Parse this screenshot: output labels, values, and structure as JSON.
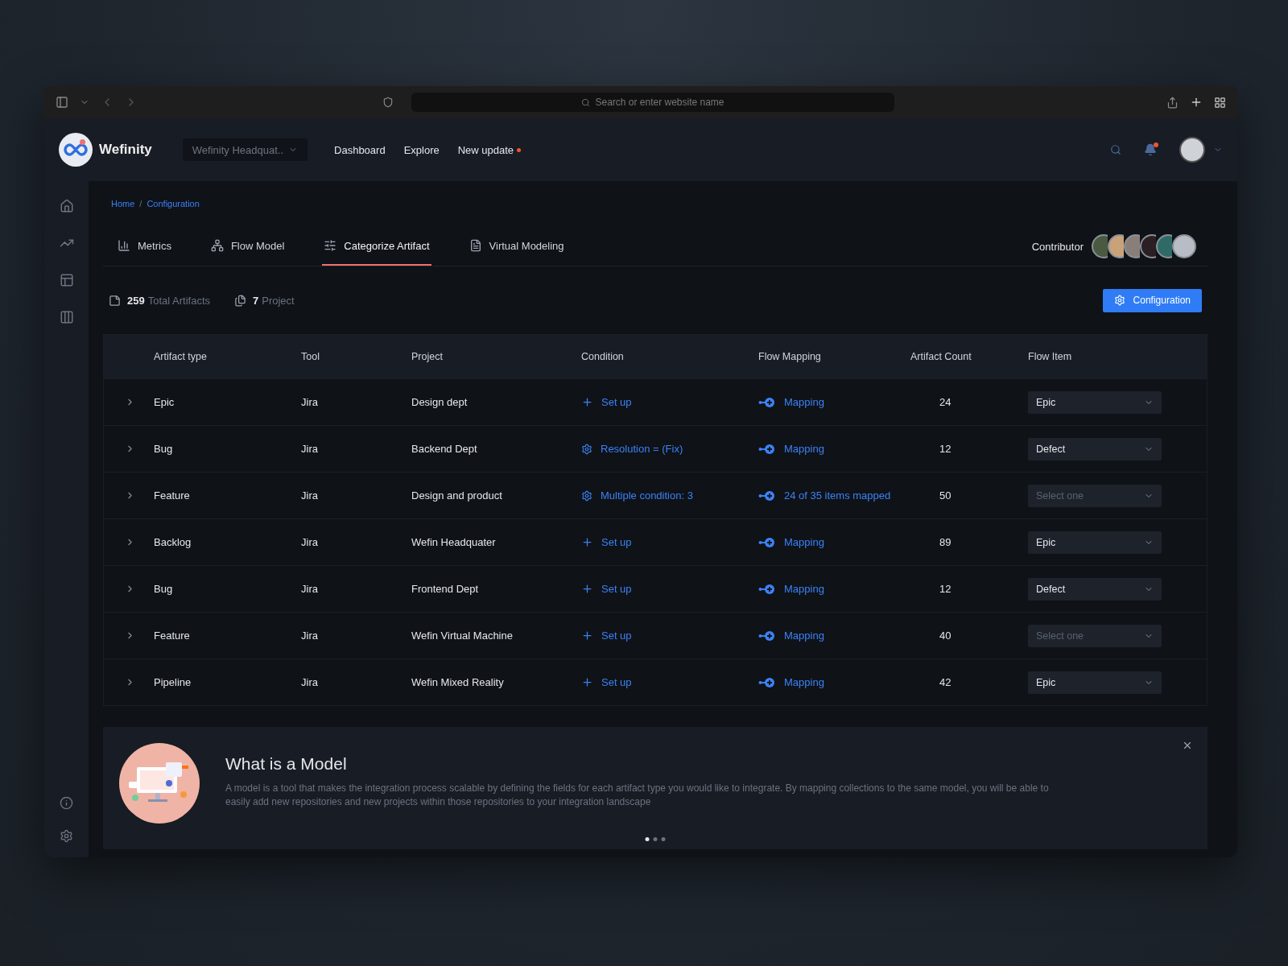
{
  "browser": {
    "address_placeholder": "Search or enter website name"
  },
  "header": {
    "brand": "Wefinity",
    "workspace": "Wefinity Headquat..",
    "nav": [
      {
        "label": "Dashboard",
        "badge": false
      },
      {
        "label": "Explore",
        "badge": false
      },
      {
        "label": "New update",
        "badge": true
      }
    ],
    "notifications": true
  },
  "sidebar": {
    "items": [
      {
        "kind": "home",
        "selected": false
      },
      {
        "kind": "chart",
        "selected": false
      },
      {
        "kind": "layout",
        "selected": false
      },
      {
        "kind": "board",
        "selected": false
      }
    ],
    "bottom": [
      {
        "kind": "info"
      },
      {
        "kind": "settings"
      }
    ]
  },
  "breadcrumb": {
    "items": [
      "Home",
      "Configuration"
    ],
    "separator": "/"
  },
  "tabs": [
    {
      "label": "Metrics",
      "kind": "metrics",
      "selected": false
    },
    {
      "label": "Flow Model",
      "kind": "flow",
      "selected": false
    },
    {
      "label": "Categorize Artifact",
      "kind": "sliders",
      "selected": true
    },
    {
      "label": "Virtual Modeling",
      "kind": "doc",
      "selected": false
    }
  ],
  "contributors": {
    "label": "Contributor",
    "avatars": [
      {
        "color": "#4a5a40"
      },
      {
        "color": "#c9a27a"
      },
      {
        "color": "#8a7f78"
      },
      {
        "color": "#2a2024"
      },
      {
        "color": "#2f6a66"
      },
      {
        "color": "#b8bcc4"
      }
    ]
  },
  "stats": [
    {
      "value": "259",
      "label": "Total Artifacts",
      "kind": "artifact"
    },
    {
      "value": "7",
      "label": "Project",
      "kind": "project"
    }
  ],
  "config_button": "Configuration",
  "table": {
    "columns": [
      "Artifact type",
      "Tool",
      "Project",
      "Condition",
      "Flow Mapping",
      "Artifact Count",
      "Flow Item"
    ],
    "rows": [
      {
        "type": "Epic",
        "tool": "Jira",
        "project": "Design dept",
        "condition": {
          "kind": "setup",
          "text": "Set up"
        },
        "mapping": "Mapping",
        "count": "24",
        "flow_item": {
          "value": "Epic"
        }
      },
      {
        "type": "Bug",
        "tool": "Jira",
        "project": "Backend Dept",
        "condition": {
          "kind": "rule",
          "text": "Resolution = (Fix)"
        },
        "mapping": "Mapping",
        "count": "12",
        "flow_item": {
          "value": "Defect"
        }
      },
      {
        "type": "Feature",
        "tool": "Jira",
        "project": "Design and product",
        "condition": {
          "kind": "rule",
          "text": "Multiple condition: 3"
        },
        "mapping": "24 of 35 items mapped",
        "count": "50",
        "flow_item": {
          "placeholder": "Select one"
        }
      },
      {
        "type": "Backlog",
        "tool": "Jira",
        "project": "Wefin Headquater",
        "condition": {
          "kind": "setup",
          "text": "Set up"
        },
        "mapping": "Mapping",
        "count": "89",
        "flow_item": {
          "value": "Epic"
        }
      },
      {
        "type": "Bug",
        "tool": "Jira",
        "project": "Frontend  Dept",
        "condition": {
          "kind": "setup",
          "text": "Set up"
        },
        "mapping": "Mapping",
        "count": "12",
        "flow_item": {
          "value": "Defect"
        }
      },
      {
        "type": "Feature",
        "tool": "Jira",
        "project": "Wefin Virtual Machine",
        "condition": {
          "kind": "setup",
          "text": "Set up"
        },
        "mapping": "Mapping",
        "count": "40",
        "flow_item": {
          "placeholder": "Select one"
        }
      },
      {
        "type": "Pipeline",
        "tool": "Jira",
        "project": "Wefin Mixed Reality",
        "condition": {
          "kind": "setup",
          "text": "Set up"
        },
        "mapping": "Mapping",
        "count": "42",
        "flow_item": {
          "value": "Epic"
        }
      }
    ]
  },
  "info_card": {
    "title": "What is a Model",
    "body": "A model is a tool that makes the integration process scalable by defining the fields for each artifact type you would like to integrate. By mapping collections to the same model, you will be able to easily add new repositories and new projects within those repositories to your integration landscape",
    "dots": [
      {
        "selected": true
      },
      {
        "selected": false
      },
      {
        "selected": false
      }
    ]
  }
}
